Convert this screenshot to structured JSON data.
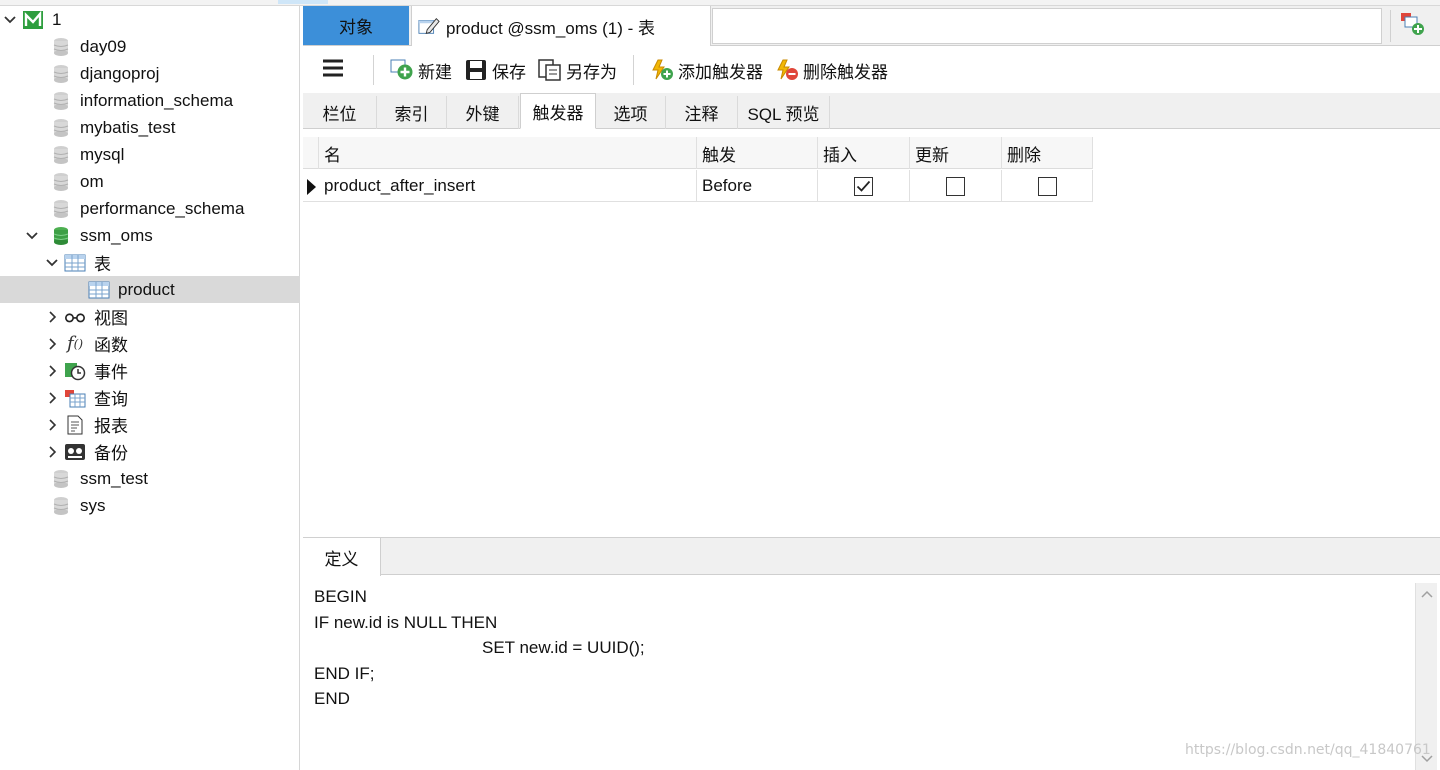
{
  "tree": {
    "connection": "1",
    "databases": [
      "day09",
      "djangoproj",
      "information_schema",
      "mybatis_test",
      "mysql",
      "om",
      "performance_schema",
      "ssm_oms"
    ],
    "ssm_oms_children": {
      "tables_label": "表",
      "selected_table": "product",
      "views": "视图",
      "functions": "函数",
      "events": "事件",
      "queries": "查询",
      "reports": "报表",
      "backups": "备份"
    },
    "more_databases": [
      "ssm_test",
      "sys"
    ]
  },
  "tabs": {
    "objects": "对象",
    "active": "product @ssm_oms (1) - 表"
  },
  "toolbar": {
    "new": "新建",
    "save": "保存",
    "save_as": "另存为",
    "add_trigger": "添加触发器",
    "delete_trigger": "删除触发器"
  },
  "subtabs": [
    "栏位",
    "索引",
    "外键",
    "触发器",
    "选项",
    "注释",
    "SQL 预览"
  ],
  "active_subtab": "触发器",
  "grid": {
    "headers": {
      "name": "名",
      "fire": "触发",
      "insert": "插入",
      "update": "更新",
      "delete": "删除"
    },
    "rows": [
      {
        "name": "product_after_insert",
        "fire": "Before",
        "insert": true,
        "update": false,
        "delete": false
      }
    ]
  },
  "definition": {
    "tab_label": "定义",
    "lines": [
      "BEGIN",
      "IF new.id is NULL THEN",
      "\t\t\tSET new.id = UUID();",
      "END IF;",
      "END"
    ]
  },
  "watermark": "https://blog.csdn.net/qq_41840761",
  "colors": {
    "accent": "#3c8fd9",
    "selected_row": "#d9d9d9",
    "db_green": "#2e9e3e"
  }
}
